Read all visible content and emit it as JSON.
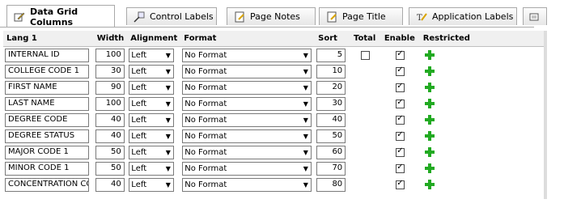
{
  "tabs": [
    {
      "label": "Data Grid Columns",
      "icon": "edit-icon",
      "active": true
    },
    {
      "label": "Control Labels",
      "icon": "pointer-icon",
      "active": false
    },
    {
      "label": "Page Notes",
      "icon": "note-icon",
      "active": false
    },
    {
      "label": "Page Title",
      "icon": "edit-icon",
      "active": false
    },
    {
      "label": "Application Labels",
      "icon": "text-icon",
      "active": false
    }
  ],
  "grid": {
    "headers": [
      "Lang 1",
      "Width",
      "Alignment",
      "Format",
      "Sort",
      "Total",
      "Enable",
      "Restricted"
    ],
    "rows": [
      {
        "lang": "INTERNAL ID",
        "width": "100",
        "align": "Left",
        "format": "No Format",
        "sort": "5",
        "total": false,
        "enable": true
      },
      {
        "lang": "COLLEGE CODE 1",
        "width": "30",
        "align": "Left",
        "format": "No Format",
        "sort": "10",
        "total": null,
        "enable": true
      },
      {
        "lang": "FIRST NAME",
        "width": "90",
        "align": "Left",
        "format": "No Format",
        "sort": "20",
        "total": null,
        "enable": true
      },
      {
        "lang": "LAST NAME",
        "width": "100",
        "align": "Left",
        "format": "No Format",
        "sort": "30",
        "total": null,
        "enable": true
      },
      {
        "lang": "DEGREE CODE",
        "width": "40",
        "align": "Left",
        "format": "No Format",
        "sort": "40",
        "total": null,
        "enable": true
      },
      {
        "lang": "DEGREE STATUS",
        "width": "40",
        "align": "Left",
        "format": "No Format",
        "sort": "50",
        "total": null,
        "enable": true
      },
      {
        "lang": "MAJOR CODE 1",
        "width": "50",
        "align": "Left",
        "format": "No Format",
        "sort": "60",
        "total": null,
        "enable": true
      },
      {
        "lang": "MINOR CODE 1",
        "width": "50",
        "align": "Left",
        "format": "No Format",
        "sort": "70",
        "total": null,
        "enable": true
      },
      {
        "lang": "CONCENTRATION COD",
        "width": "40",
        "align": "Left",
        "format": "No Format",
        "sort": "80",
        "total": null,
        "enable": true
      }
    ]
  }
}
